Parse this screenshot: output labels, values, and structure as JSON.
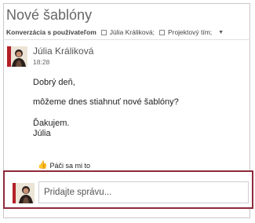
{
  "header": {
    "title": "Nové šablóny",
    "conversation_label": "Konverzácia s používateľom",
    "participant_1": "Júlia Králiková;",
    "participant_2": "Projektový tím;"
  },
  "message": {
    "sender": "Júlia Králiková",
    "time": "18:28",
    "line_1": "Dobrý deň,",
    "line_2": "môžeme dnes stiahnuť nové šablóny?",
    "line_3": "Ďakujem.",
    "line_4": "Júlia"
  },
  "actions": {
    "like_label": "Páči sa mi to"
  },
  "reply": {
    "placeholder": "Pridajte správu..."
  },
  "colors": {
    "reply_border": "#8f2a3b",
    "avatar_accent": "#b31f26"
  }
}
